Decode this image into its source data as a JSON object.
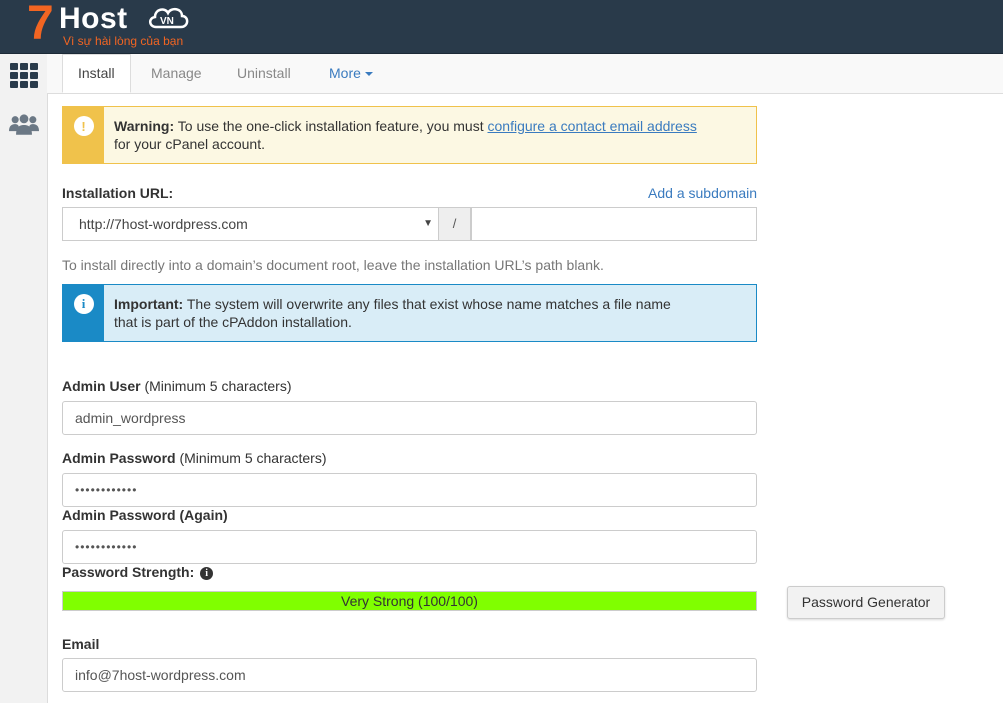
{
  "brand": {
    "seven": "7",
    "host": "Host",
    "cloud_text": "VN",
    "tagline": "Vì sự hài lòng của bạn"
  },
  "sidebar": {
    "icons": [
      "grid-icon",
      "users-icon"
    ]
  },
  "tabs": {
    "install": "Install",
    "manage": "Manage",
    "uninstall": "Uninstall",
    "more": "More"
  },
  "warning": {
    "icon": "exclamation-icon",
    "strong": "Warning:",
    "text_before": " To use the one-click installation feature, you must ",
    "link": "configure a contact email address",
    "text_after": "for your cPanel account."
  },
  "install_url": {
    "label": "Installation URL:",
    "add_subdomain": "Add a subdomain",
    "domain_value": "http://7host-wordpress.com",
    "separator": "/",
    "path_value": "",
    "help": "To install directly into a domain’s document root, leave the installation URL’s path blank."
  },
  "important": {
    "icon": "info-icon",
    "strong": "Important:",
    "line1": " The system will overwrite any files that exist whose name matches a file name",
    "line2": "that is part of the cPAddon installation."
  },
  "admin_user": {
    "label": "Admin User",
    "hint": " (Minimum 5 characters)",
    "value": "admin_wordpress"
  },
  "admin_password": {
    "label": "Admin Password",
    "hint": " (Minimum 5 characters)",
    "value": "••••••••••••"
  },
  "admin_password_again": {
    "label": "Admin Password (Again)",
    "value": "••••••••••••"
  },
  "strength": {
    "label": "Password Strength:",
    "text": "Very Strong (100/100)",
    "percent": 100,
    "color": "#80ff00"
  },
  "password_generator": "Password Generator",
  "email": {
    "label": "Email",
    "value": "info@7host-wordpress.com"
  },
  "colors": {
    "header": "#293a4a",
    "accent": "#f26522",
    "link": "#3a7bbf",
    "warning": "#f0c24b",
    "info": "#1a8ac6"
  }
}
